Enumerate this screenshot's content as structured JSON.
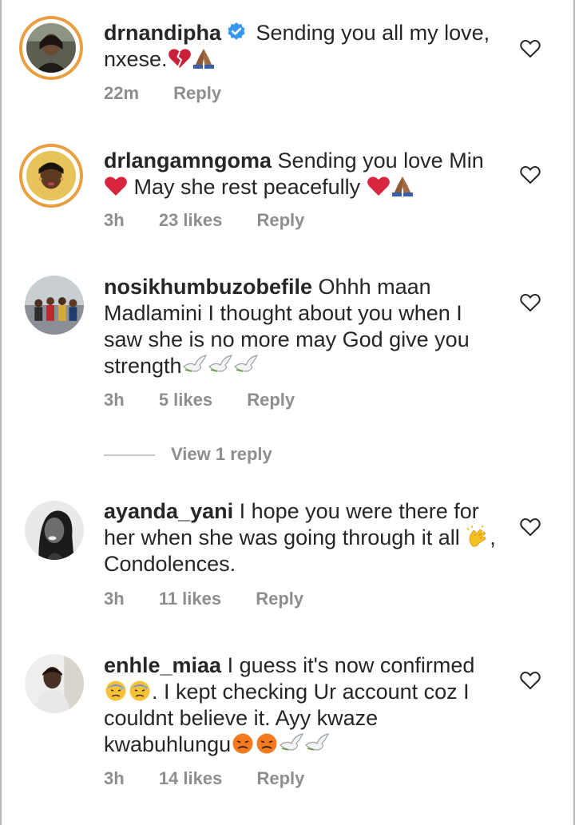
{
  "comments": [
    {
      "username": "drnandipha",
      "verified": true,
      "text": "Sending you all my love, nxese.",
      "emoji_after": [
        "broken-heart-emoji",
        "folded-hands-emoji"
      ],
      "time": "22m",
      "likes": "",
      "reply_label": "Reply",
      "avatar_ring": true
    },
    {
      "username": "drlangamngoma",
      "verified": false,
      "text_part1": "Sending you love Min",
      "text_part2": "May she rest peacefully",
      "time": "3h",
      "likes": "23 likes",
      "reply_label": "Reply",
      "avatar_ring": true
    },
    {
      "username": "nosikhumbuzobefile",
      "verified": false,
      "text": "Ohhh maan Madlamini I thought about you when I saw she is no more may God give you strength",
      "time": "3h",
      "likes": "5 likes",
      "reply_label": "Reply",
      "view_replies_label": "View 1 reply"
    },
    {
      "username": "ayanda_yani",
      "verified": false,
      "text": "I hope you were there for her when she was going through it all",
      "text_part2": ", Condolences.",
      "time": "3h",
      "likes": "11 likes",
      "reply_label": "Reply"
    },
    {
      "username": "enhle_miaa",
      "verified": false,
      "text": "I guess it's now confirmed",
      "text_part2": ". I kept checking Ur account coz I couldnt believe it. Ayy kwaze kwabuhlungu",
      "time": "3h",
      "likes": "14 likes",
      "reply_label": "Reply"
    }
  ],
  "colors": {
    "text": "#262626",
    "meta": "#8e8e8e",
    "verified_blue": "#3897f0",
    "story_ring": "#ea9e3f",
    "red_heart": "#d7263d"
  }
}
